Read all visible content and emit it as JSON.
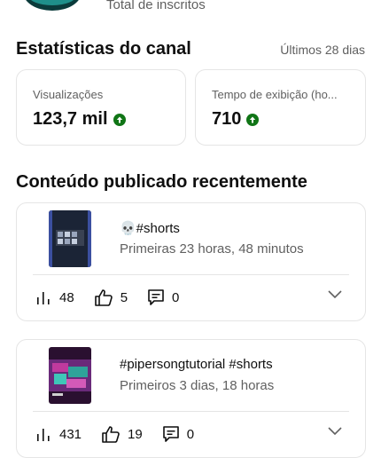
{
  "header": {
    "subscribers_label": "Total de inscritos"
  },
  "stats": {
    "title": "Estatísticas do canal",
    "range": "Últimos 28 dias",
    "cards": [
      {
        "label": "Visualizações",
        "value": "123,7 mil",
        "trend": "up"
      },
      {
        "label": "Tempo de exibição (ho...",
        "value": "710",
        "trend": "up"
      }
    ]
  },
  "recent": {
    "title": "Conteúdo publicado recentemente",
    "videos": [
      {
        "title": "💀#shorts",
        "subtitle": "Primeiras 23 horas, 48 minutos",
        "views": "48",
        "likes": "5",
        "comments": "0"
      },
      {
        "title": "#pipersongtutorial #shorts",
        "subtitle": "Primeiros 3 dias, 18 horas",
        "views": "431",
        "likes": "19",
        "comments": "0"
      }
    ]
  },
  "colors": {
    "accent_up": "#107516",
    "muted_text": "#606060",
    "border": "#e5e5e5"
  }
}
